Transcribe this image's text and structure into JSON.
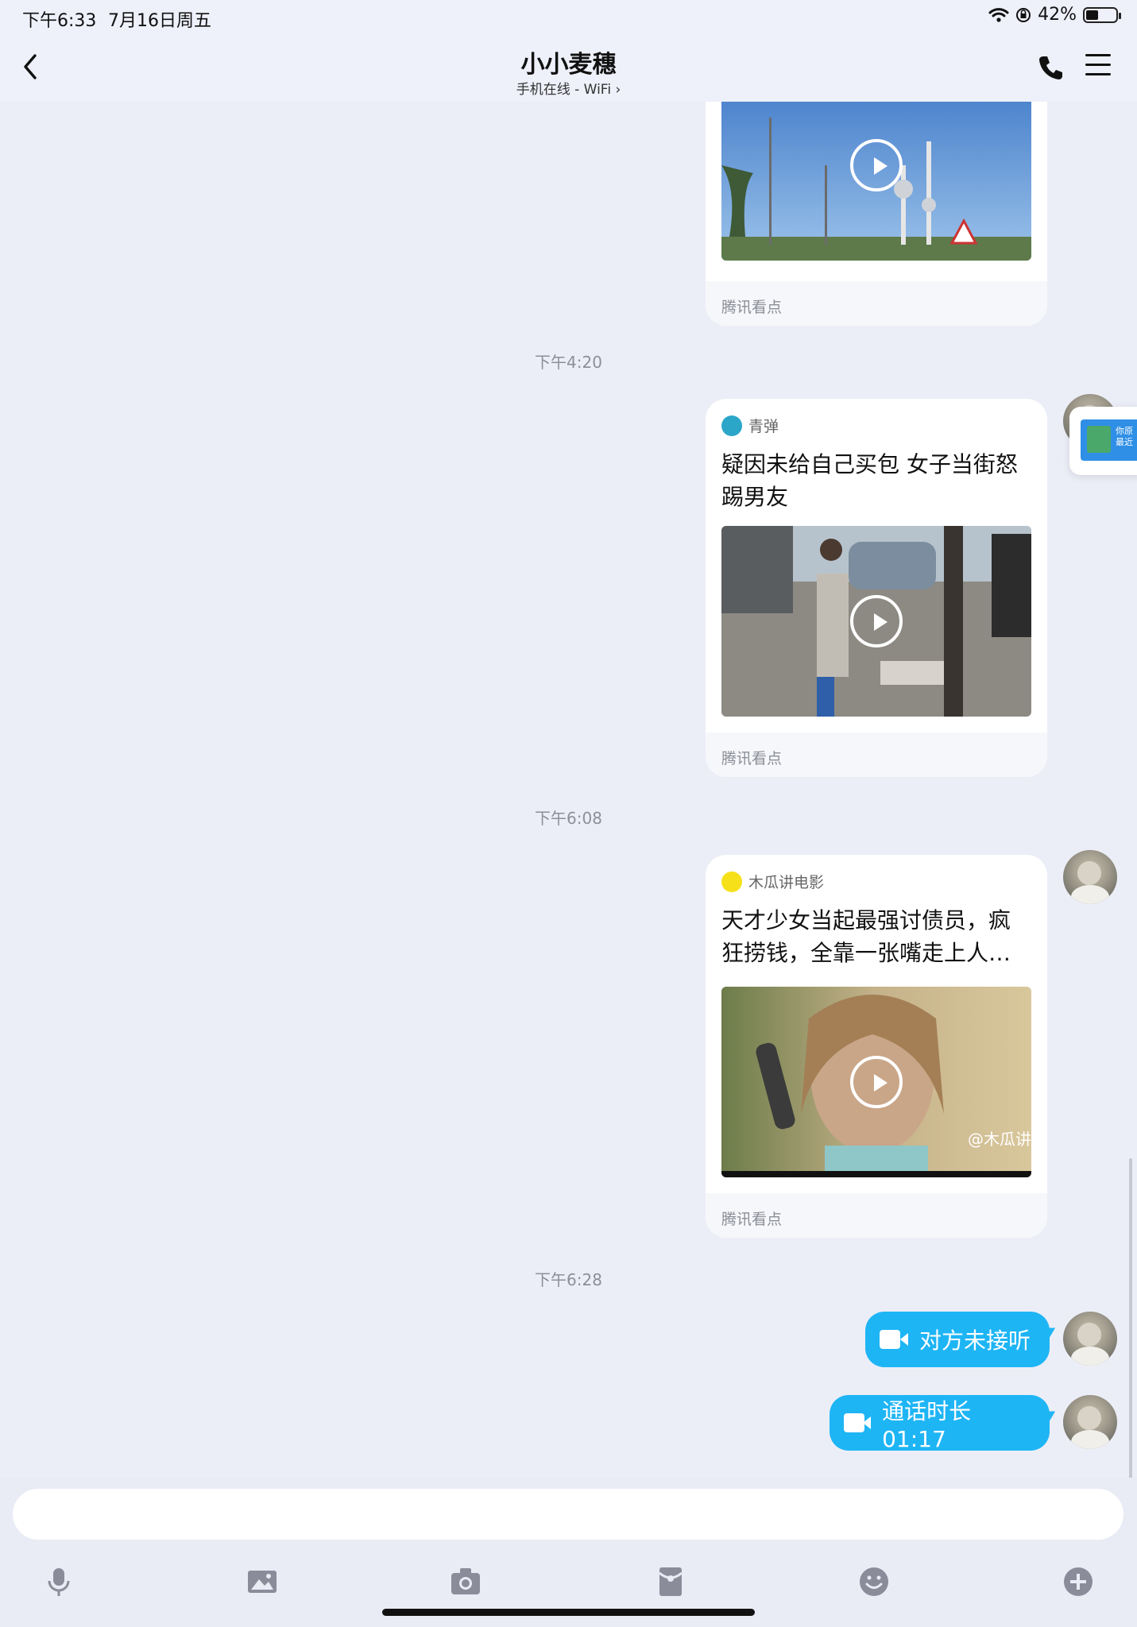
{
  "status_bar": {
    "time": "下午6:33",
    "date": "7月16日周五",
    "battery": "42%",
    "battery_level": 0.42
  },
  "header": {
    "title": "小小麦穗",
    "subtitle": "手机在线 - WiFi"
  },
  "timestamps": [
    "下午4:20",
    "下午6:08",
    "下午6:28"
  ],
  "cards": [
    {
      "footer": "腾讯看点"
    },
    {
      "source": "青弹",
      "title": "疑因未给自己买包 女子当街怒踢男友",
      "footer": "腾讯看点"
    },
    {
      "source": "木瓜讲电影",
      "title": "天才少女当起最强讨债员，疯狂捞钱，全靠一张嘴走上人…",
      "thumb_watermark": "@木瓜讲",
      "footer": "腾讯看点"
    }
  ],
  "calls": [
    {
      "text": "对方未接听"
    },
    {
      "text": "通话时长 01:17"
    }
  ],
  "floating_widget": {
    "text": "你原 最近"
  },
  "input": {
    "placeholder": ""
  },
  "colors": {
    "accent": "#1eb5f5",
    "background": "#eceef7",
    "toolbar_icon": "#8a8d99"
  },
  "toolbar_icons": [
    "mic-icon",
    "image-icon",
    "camera-icon",
    "red-packet-icon",
    "emoji-icon",
    "plus-icon"
  ]
}
